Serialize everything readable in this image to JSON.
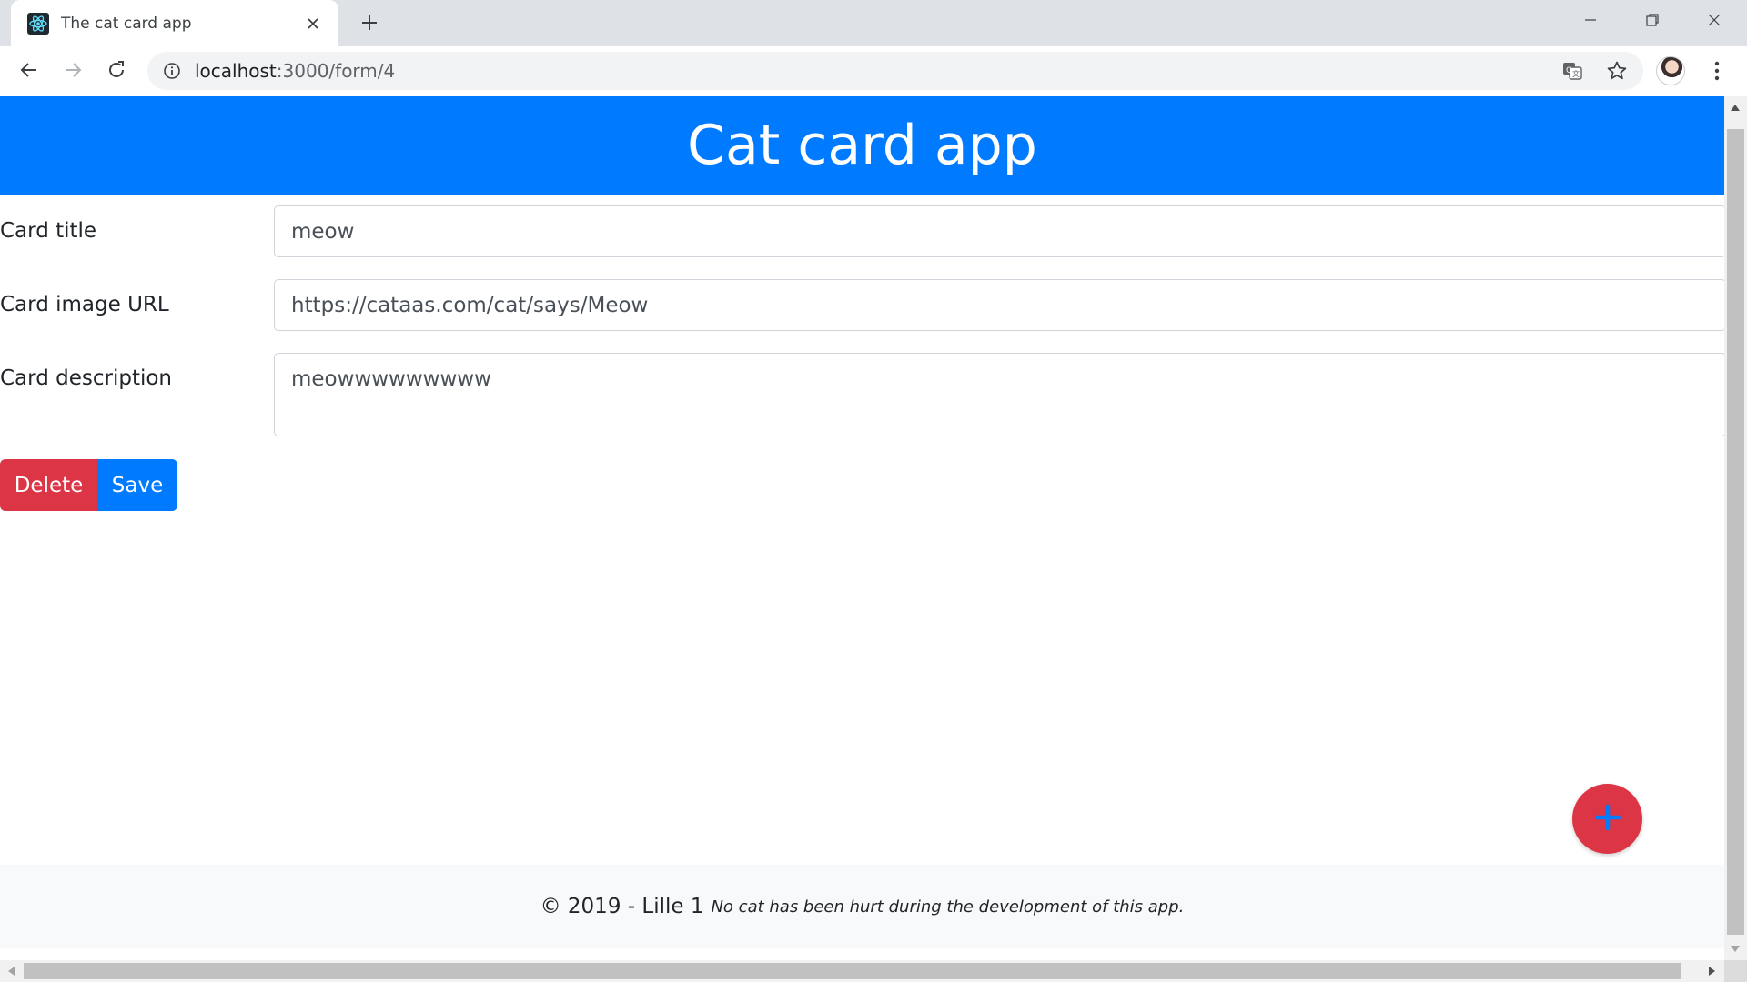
{
  "browser": {
    "tab_title": "The cat card app",
    "url_host": "localhost",
    "url_path": ":3000/form/4"
  },
  "page": {
    "header_title": "Cat card app",
    "form": {
      "title_label": "Card title",
      "title_value": "meow",
      "image_label": "Card image URL",
      "image_value": "https://cataas.com/cat/says/Meow",
      "description_label": "Card description",
      "description_value": "meowwwwwwwww"
    },
    "buttons": {
      "delete_label": "Delete",
      "save_label": "Save"
    },
    "footer": {
      "copyright": "© 2019 - Lille 1",
      "note": "No cat has been hurt during the development of this app."
    }
  },
  "colors": {
    "primary": "#007bff",
    "danger": "#dc3545",
    "footer_bg": "#f8f9fa"
  }
}
